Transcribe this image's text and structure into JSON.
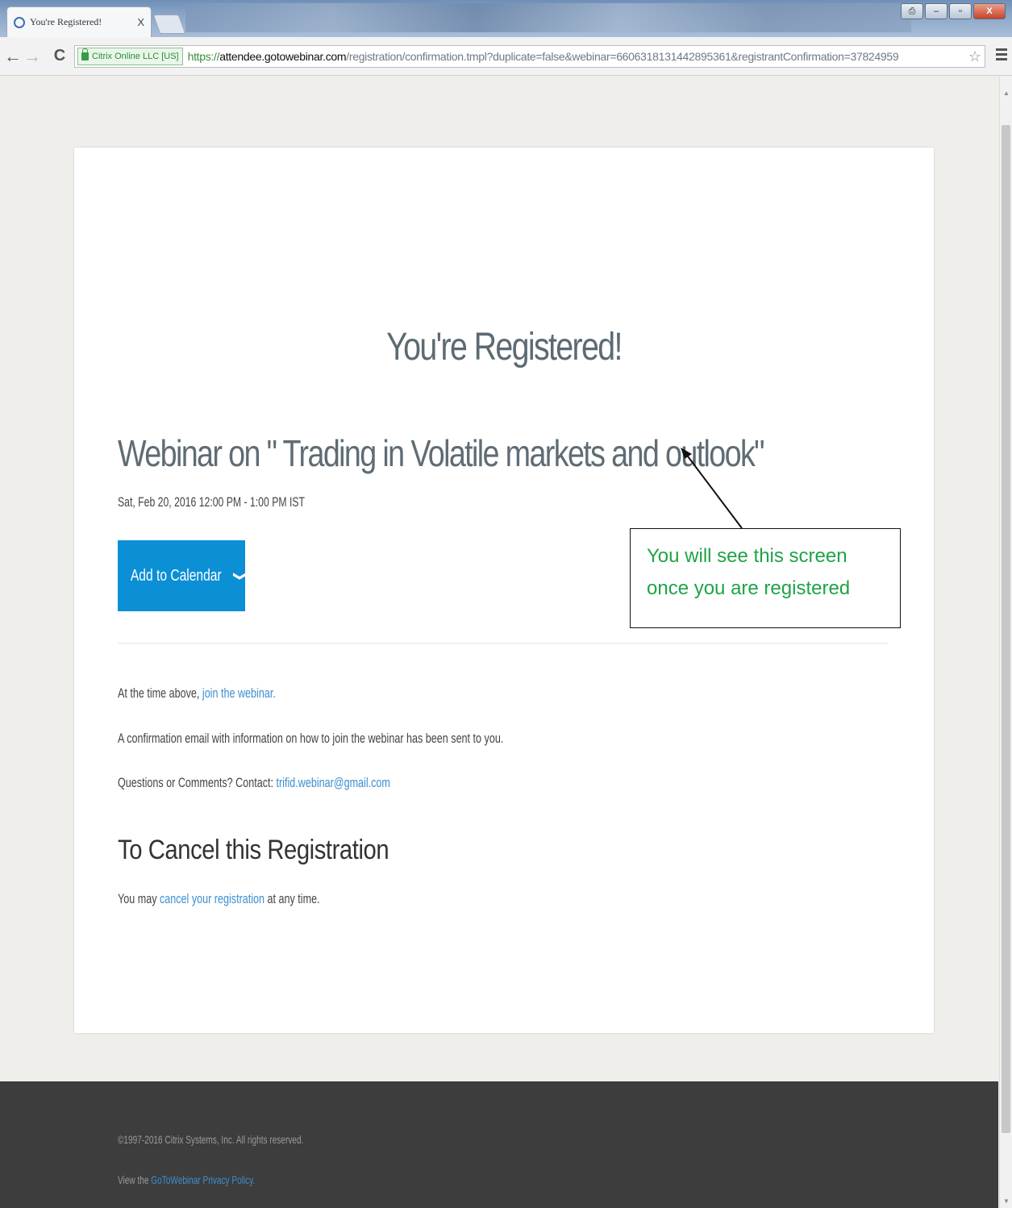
{
  "browser": {
    "tab_title": "You're Registered!",
    "tab_close": "X",
    "back_glyph": "←",
    "forward_glyph": "→",
    "reload_glyph": "C",
    "ev_badge": "Citrix Online LLC [US]",
    "url_protocol": "https://",
    "url_host": "attendee.gotowebinar.com",
    "url_path": "/registration/confirmation.tmpl?duplicate=false&webinar=6606318131442895361&registrantConfirmation=37824959",
    "star_glyph": "☆",
    "window_buttons": [
      "⎙",
      "–",
      "▫",
      "X"
    ]
  },
  "page": {
    "heading": "You're Registered!",
    "webinar_title": "Webinar on \" Trading in Volatile markets and outlook\"",
    "webinar_time": "Sat, Feb 20, 2016 12:00 PM - 1:00 PM IST",
    "calendar_button": "Add to Calendar",
    "calendar_chevron": "❯",
    "join_prefix": "At the time above, ",
    "join_link": "join the webinar.",
    "confirmation_text": "A confirmation email with information on how to join the webinar has been sent to you.",
    "contact_prefix": "Questions or Comments? Contact: ",
    "contact_email": "trifid.webinar@gmail.com",
    "cancel_heading": "To Cancel this Registration",
    "cancel_prefix": "You may ",
    "cancel_link": "cancel your registration",
    "cancel_suffix": " at any time."
  },
  "footer": {
    "copyright": "©1997-2016 Citrix Systems, Inc. All rights reserved.",
    "privacy_prefix": "View the ",
    "privacy_link": "GoToWebinar Privacy Policy."
  },
  "annotation": {
    "line1": "You will see this screen",
    "line2": "once you are registered"
  },
  "colors": {
    "button_blue": "#0b8fd5",
    "link_blue": "#3c8fcf",
    "annotation_green": "#1fa347",
    "footer_bg": "#3d3d3d"
  }
}
